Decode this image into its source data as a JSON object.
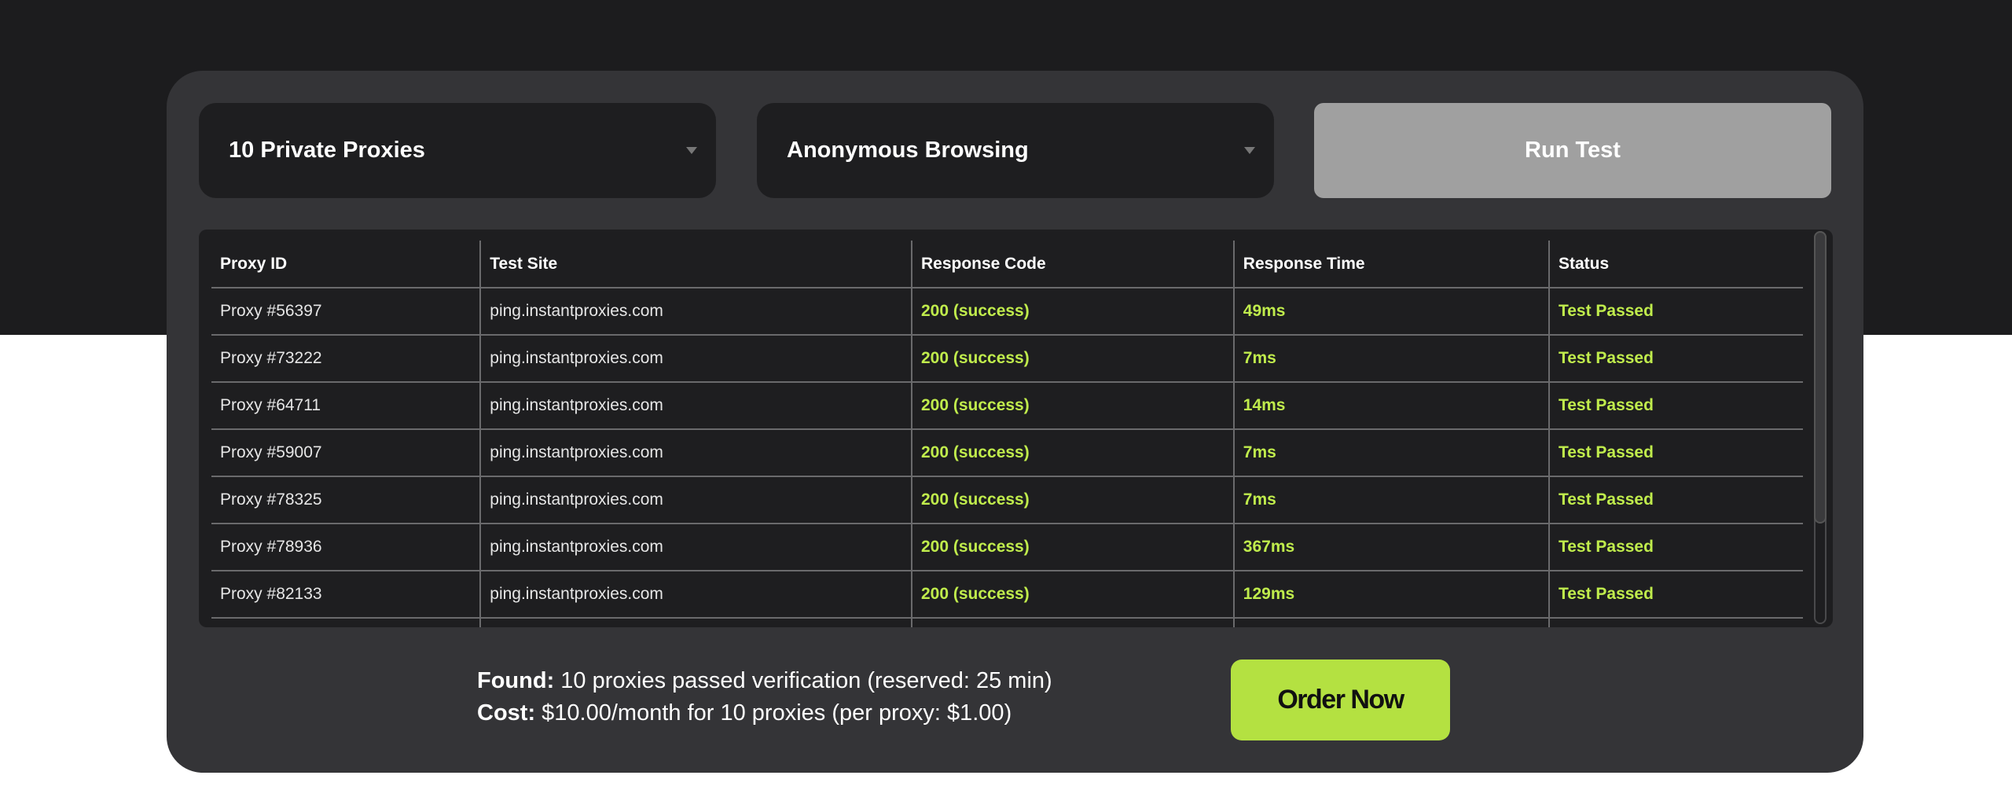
{
  "controls": {
    "proxy_package": "10 Private Proxies",
    "use_case": "Anonymous Browsing",
    "run_test_label": "Run Test"
  },
  "table": {
    "headers": [
      "Proxy ID",
      "Test Site",
      "Response Code",
      "Response Time",
      "Status"
    ],
    "rows": [
      [
        "Proxy #56397",
        "ping.instantproxies.com",
        "200 (success)",
        "49ms",
        "Test Passed"
      ],
      [
        "Proxy #73222",
        "ping.instantproxies.com",
        "200 (success)",
        "7ms",
        "Test Passed"
      ],
      [
        "Proxy #64711",
        "ping.instantproxies.com",
        "200 (success)",
        "14ms",
        "Test Passed"
      ],
      [
        "Proxy #59007",
        "ping.instantproxies.com",
        "200 (success)",
        "7ms",
        "Test Passed"
      ],
      [
        "Proxy #78325",
        "ping.instantproxies.com",
        "200 (success)",
        "7ms",
        "Test Passed"
      ],
      [
        "Proxy #78936",
        "ping.instantproxies.com",
        "200 (success)",
        "367ms",
        "Test Passed"
      ],
      [
        "Proxy #82133",
        "ping.instantproxies.com",
        "200 (success)",
        "129ms",
        "Test Passed"
      ]
    ]
  },
  "summary": {
    "found_label": "Found:",
    "found_text": " 10 proxies passed verification (reserved: 25 min)",
    "cost_label": "Cost:",
    "cost_text": " $10.00/month for 10 proxies (per proxy: $1.00)"
  },
  "order_label": "Order Now",
  "colors": {
    "accent": "#b4e141",
    "success_text": "#c0ec4c",
    "card": "#343437",
    "background_dark": "#1c1c1e"
  }
}
